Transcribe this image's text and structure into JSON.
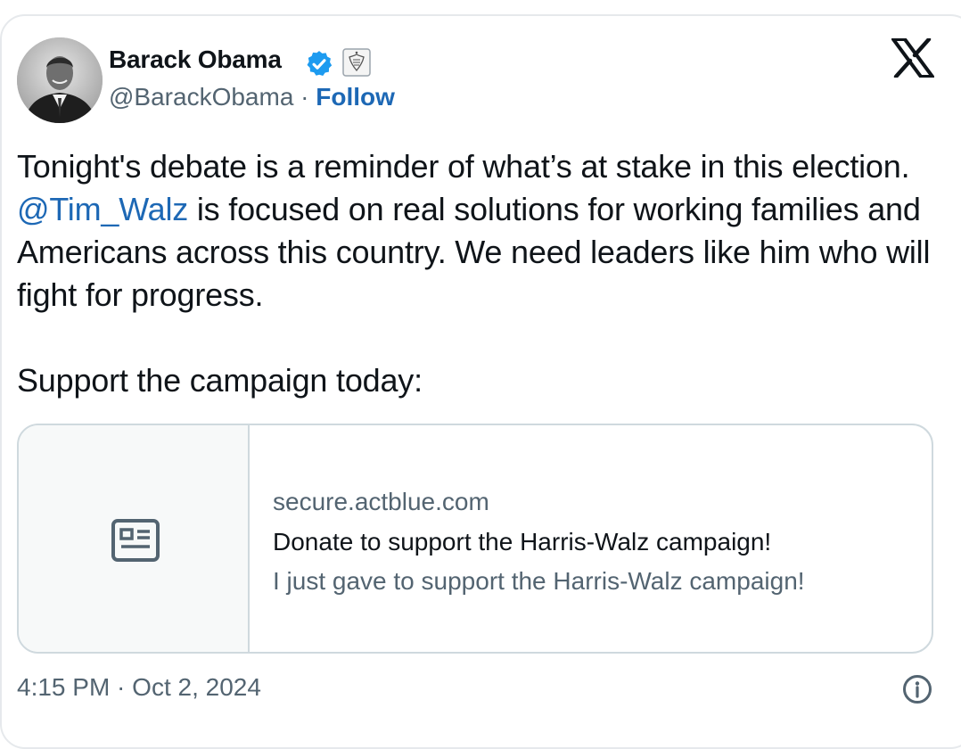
{
  "author": {
    "name": "Barack Obama",
    "handle": "@BarackObama",
    "separator": " · ",
    "follow_label": "Follow",
    "badges": [
      "verified-icon",
      "government-seal-icon"
    ]
  },
  "header": {
    "logo_icon": "x-logo-icon"
  },
  "tweet": {
    "line1": "Tonight's debate is a reminder of what’s at stake in this election. ",
    "mention": "@Tim_Walz",
    "line2": " is focused on real solutions for working families and Americans across this country. We need leaders like him who will fight for progress.",
    "support_line": "Support the campaign today:"
  },
  "link_card": {
    "thumbnail_icon": "news-article-icon",
    "domain": "secure.actblue.com",
    "title": "Donate to support the Harris-Walz campaign!",
    "description": "I just gave to support the Harris-Walz campaign!"
  },
  "footer": {
    "timestamp": "4:15 PM · Oct 2, 2024",
    "info_icon": "info-icon"
  },
  "colors": {
    "link_blue": "#1d68b5",
    "verified_blue": "#1d9bf0",
    "text": "#0f1419",
    "muted": "#536471",
    "border": "#cfd9de"
  }
}
